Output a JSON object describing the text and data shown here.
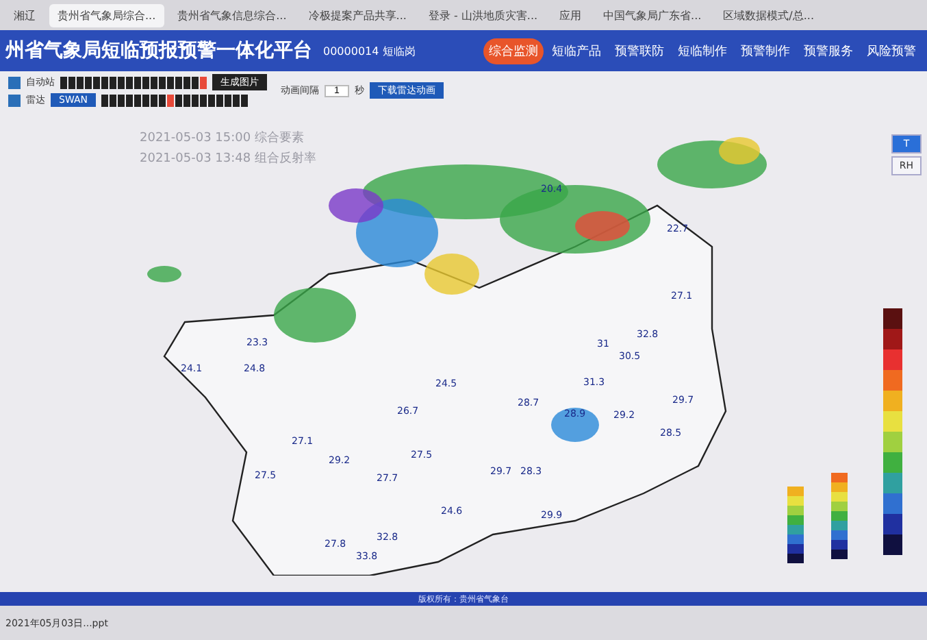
{
  "browser_tabs": [
    {
      "label": "湘辽",
      "selected": false
    },
    {
      "label": "贵州省气象局综合...",
      "selected": true
    },
    {
      "label": "贵州省气象信息综合...",
      "selected": false
    },
    {
      "label": "冷极提案产品共享...",
      "selected": false
    },
    {
      "label": "登录 - 山洪地质灾害...",
      "selected": false
    },
    {
      "label": "应用",
      "selected": false
    },
    {
      "label": "中国气象局广东省...",
      "selected": false
    },
    {
      "label": "区域数据模式/总...",
      "selected": false
    }
  ],
  "header": {
    "title": "州省气象局短临预报预警一体化平台",
    "user": "00000014 短临岗",
    "nav": [
      {
        "label": "综合监测",
        "selected": true
      },
      {
        "label": "短临产品",
        "selected": false
      },
      {
        "label": "预警联防",
        "selected": false
      },
      {
        "label": "短临制作",
        "selected": false
      },
      {
        "label": "预警制作",
        "selected": false
      },
      {
        "label": "预警服务",
        "selected": false
      },
      {
        "label": "风险预警",
        "selected": false
      }
    ]
  },
  "toolbar": {
    "layers": [
      {
        "label": "自动站",
        "checked": true,
        "frames": [
          {
            "selected": false
          },
          {
            "selected": false
          },
          {
            "selected": false
          },
          {
            "selected": false
          },
          {
            "selected": false
          },
          {
            "selected": false
          },
          {
            "selected": false
          },
          {
            "selected": false
          },
          {
            "selected": false
          },
          {
            "selected": false
          },
          {
            "selected": false
          },
          {
            "selected": false
          },
          {
            "selected": false
          },
          {
            "selected": false
          },
          {
            "selected": false
          },
          {
            "selected": false
          },
          {
            "selected": false
          },
          {
            "selected": true
          }
        ]
      },
      {
        "label": "雷达",
        "checked": true,
        "frames": [
          {
            "selected": false
          },
          {
            "selected": false
          },
          {
            "selected": false
          },
          {
            "selected": false
          },
          {
            "selected": false
          },
          {
            "selected": false
          },
          {
            "selected": false
          },
          {
            "selected": false
          },
          {
            "selected": true
          },
          {
            "selected": false
          },
          {
            "selected": false
          },
          {
            "selected": false
          },
          {
            "selected": false
          },
          {
            "selected": false
          },
          {
            "selected": false
          },
          {
            "selected": false
          },
          {
            "selected": false
          },
          {
            "selected": false
          }
        ]
      }
    ],
    "swan": "SWAN",
    "make_image": "生成图片",
    "interval_label": "动画间隔",
    "interval": "1",
    "unit": "秒",
    "download": "下载雷达动画"
  },
  "map": {
    "times": [
      "2021-05-03 15:00 综合要素",
      "2021-05-03 13:48 组合反射率"
    ],
    "side_buttons": [
      {
        "label": "T",
        "selected": true
      },
      {
        "label": "RH",
        "selected": false
      }
    ],
    "temperatures": [
      "20.4",
      "22.7",
      "27.1",
      "32.8",
      "23.3",
      "31",
      "30.5",
      "24.1",
      "24.8",
      "31.3",
      "24.5",
      "29.7",
      "28.7",
      "26.7",
      "28.9",
      "29.2",
      "28.5",
      "27.1",
      "27.5",
      "29.2",
      "29.7",
      "28.3",
      "27.5",
      "27.7",
      "24.6",
      "29.9",
      "32.8",
      "27.8",
      "33.8"
    ]
  },
  "footer": "版权所有：贵州省气象台",
  "taskbar": {
    "file": "2021年05月03日...ppt"
  }
}
